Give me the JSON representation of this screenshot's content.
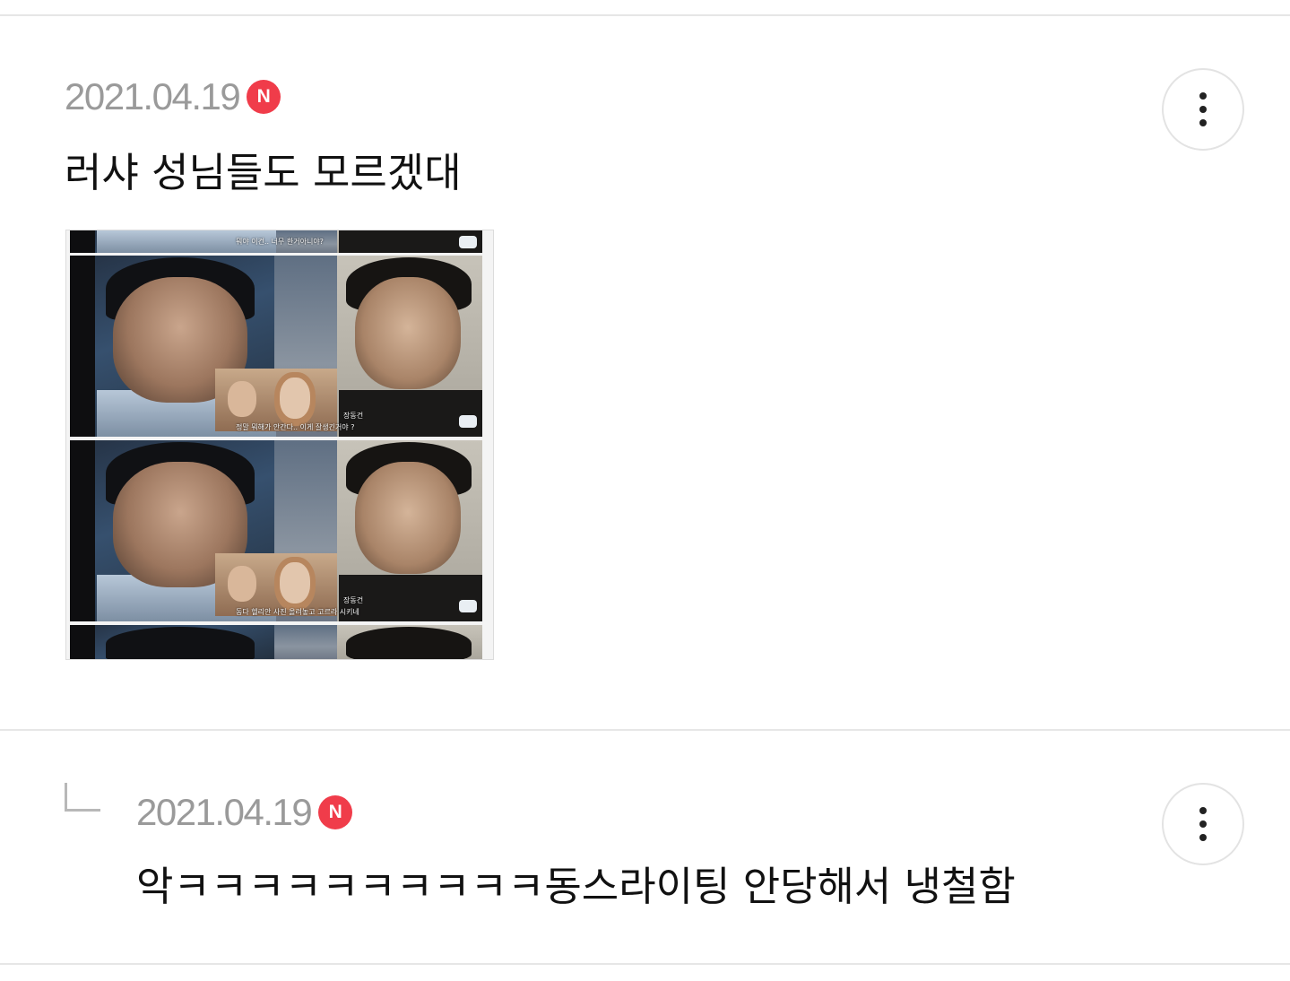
{
  "comments": [
    {
      "date": "2021.04.19",
      "badge": "N",
      "text": "러샤 성님들도 모르겠대",
      "has_image": true,
      "image_captions": [
        "뭐야 이건.. 너무 한거아니야?",
        "장동건",
        "정말 뭐해가 안간다.. 이게 잘생긴거야 ?",
        "장동건",
        "동다 헬리안 사진 올려놓고 고르라 시키네"
      ],
      "more_icon": "vertical-ellipsis-icon"
    },
    {
      "date": "2021.04.19",
      "badge": "N",
      "text": "악ㅋㅋㅋㅋㅋㅋㅋㅋㅋㅋ동스라이팅 안당해서 냉철함",
      "is_reply": true,
      "reply_icon": "reply-arrow-icon",
      "more_icon": "vertical-ellipsis-icon"
    }
  ],
  "colors": {
    "badge": "#f03c4a",
    "date": "#9a9a9a",
    "text": "#111111",
    "divider": "#e6e6e6"
  }
}
